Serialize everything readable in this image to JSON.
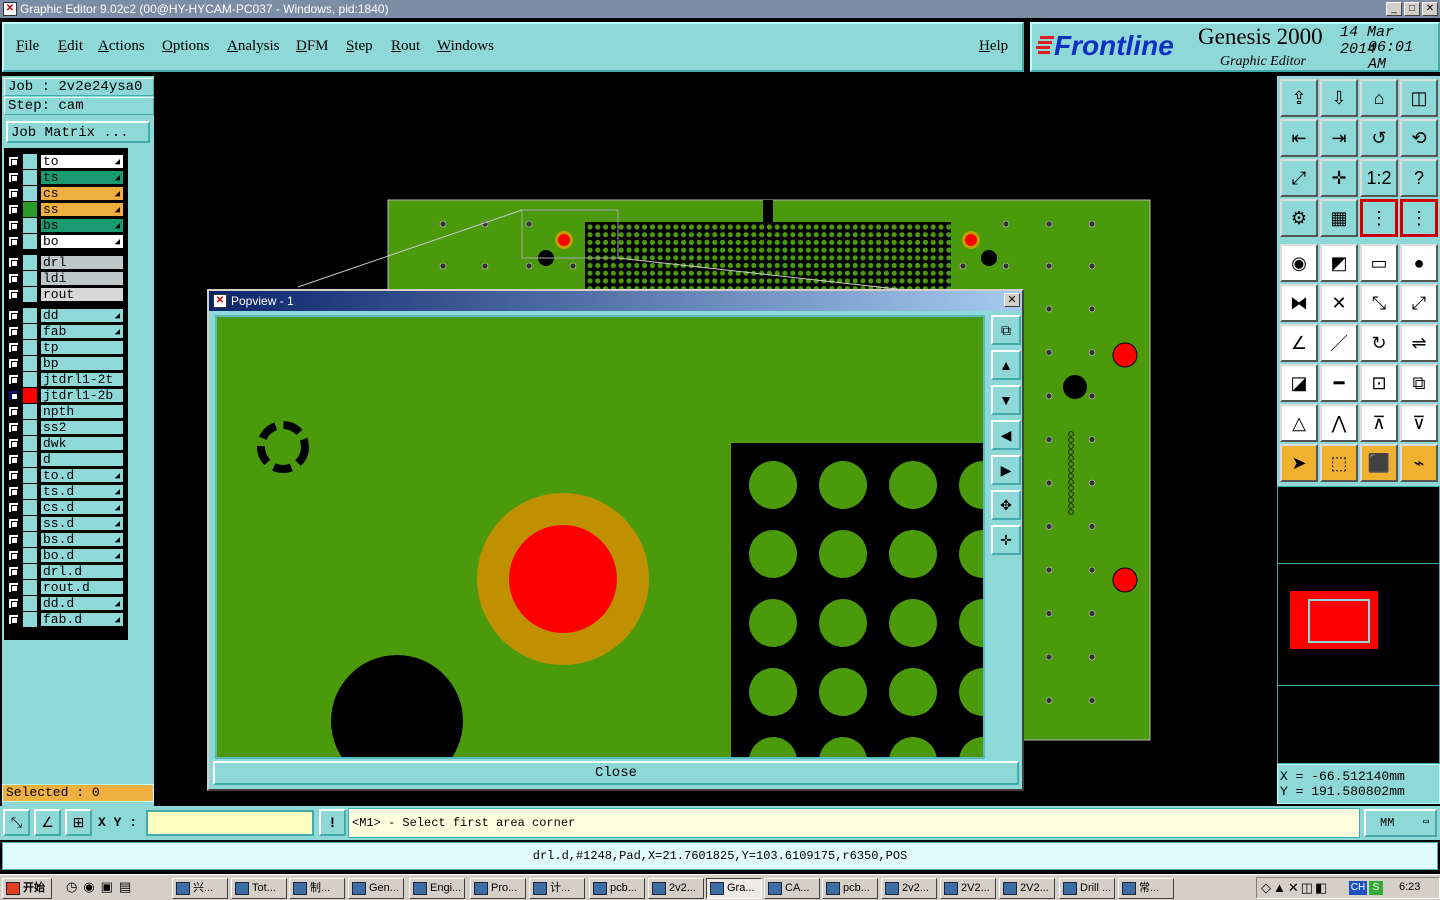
{
  "window": {
    "title": "Graphic Editor 9.02c2 (00@HY-HYCAM-PC037 - Windows, pid:1840)"
  },
  "menu": [
    "File",
    "Edit",
    "Actions",
    "Options",
    "Analysis",
    "DFM",
    "Step",
    "Rout",
    "Windows"
  ],
  "help": "Help",
  "logo": {
    "brand": "Frontline",
    "product": "Genesis 2000",
    "subtitle": "Graphic Editor",
    "date": "14 Mar 2014",
    "time": "06:01 AM"
  },
  "job": {
    "job_label": "Job : 2v2e24ysa0",
    "step_label": "Step: cam",
    "matrix_button": "Job Matrix ..."
  },
  "layers": [
    {
      "name": "to",
      "color": "#ffffff",
      "arrow": true
    },
    {
      "name": "ts",
      "color": "#1a9a70",
      "arrow": true
    },
    {
      "name": "cs",
      "color": "#f0b040",
      "arrow": true
    },
    {
      "name": "ss",
      "color": "#f0b040",
      "arrow": true,
      "swatch": "#2a9a2a"
    },
    {
      "name": "bs",
      "color": "#1a9a70",
      "arrow": true
    },
    {
      "name": "bo",
      "color": "#ffffff",
      "arrow": true
    },
    {
      "name": "drl",
      "color": "#bfc8c8",
      "group": 2
    },
    {
      "name": "ldi",
      "color": "#bfc8c8",
      "group": 2
    },
    {
      "name": "rout",
      "color": "#d8d8d8",
      "group": 2
    },
    {
      "name": "dd",
      "color": "#8fd8d8",
      "arrow": true,
      "group": 3
    },
    {
      "name": "fab",
      "color": "#8fd8d8",
      "arrow": true,
      "group": 3
    },
    {
      "name": "tp",
      "color": "#8fd8d8",
      "group": 3
    },
    {
      "name": "bp",
      "color": "#8fd8d8",
      "group": 3
    },
    {
      "name": "jtdrl1-2t",
      "color": "#8fd8d8",
      "group": 3
    },
    {
      "name": "jtdrl1-2b",
      "color": "#8fd8d8",
      "group": 3,
      "swatch": "#ff0000",
      "active": true
    },
    {
      "name": "npth",
      "color": "#8fd8d8",
      "group": 3
    },
    {
      "name": "ss2",
      "color": "#8fd8d8",
      "group": 3
    },
    {
      "name": "dwk",
      "color": "#8fd8d8",
      "group": 3
    },
    {
      "name": "d",
      "color": "#8fd8d8",
      "group": 3
    },
    {
      "name": "to.d",
      "color": "#8fd8d8",
      "arrow": true,
      "group": 3
    },
    {
      "name": "ts.d",
      "color": "#8fd8d8",
      "arrow": true,
      "group": 3
    },
    {
      "name": "cs.d",
      "color": "#8fd8d8",
      "arrow": true,
      "group": 3
    },
    {
      "name": "ss.d",
      "color": "#8fd8d8",
      "arrow": true,
      "group": 3
    },
    {
      "name": "bs.d",
      "color": "#8fd8d8",
      "arrow": true,
      "group": 3
    },
    {
      "name": "bo.d",
      "color": "#8fd8d8",
      "arrow": true,
      "group": 3
    },
    {
      "name": "drl.d",
      "color": "#8fd8d8",
      "group": 3
    },
    {
      "name": "rout.d",
      "color": "#8fd8d8",
      "group": 3
    },
    {
      "name": "dd.d",
      "color": "#8fd8d8",
      "arrow": true,
      "group": 3
    },
    {
      "name": "fab.d",
      "color": "#8fd8d8",
      "arrow": true,
      "group": 3
    }
  ],
  "selected": "Selected : 0",
  "coords": {
    "x": "X = -66.512140mm",
    "y": "Y = 191.580802mm"
  },
  "popview": {
    "title": "Popview - 1",
    "close": "Close"
  },
  "command": {
    "xy_label": "X Y :",
    "xy_value": "",
    "prompt": "<M1> - Select first area corner",
    "units": "MM",
    "bang": "!"
  },
  "status": "drl.d,#1248,Pad,X=21.7601825,Y=103.6109175,r6350,POS",
  "taskbar": {
    "start": "开始",
    "tasks": [
      "兴...",
      "Tot...",
      "制...",
      "Gen...",
      "Engi...",
      "Pro...",
      "计...",
      "pcb...",
      "2v2...",
      "Gra...",
      "CA...",
      "pcb...",
      "2v2...",
      "2V2...",
      "2V2...",
      "Drill ...",
      "常..."
    ],
    "tray_lang": "CH",
    "clock": "6:23"
  },
  "colors": {
    "board": "#4a9a0c",
    "pad_red": "#ff0000",
    "ring": "#c0a000",
    "panel": "#8fd8d8"
  }
}
